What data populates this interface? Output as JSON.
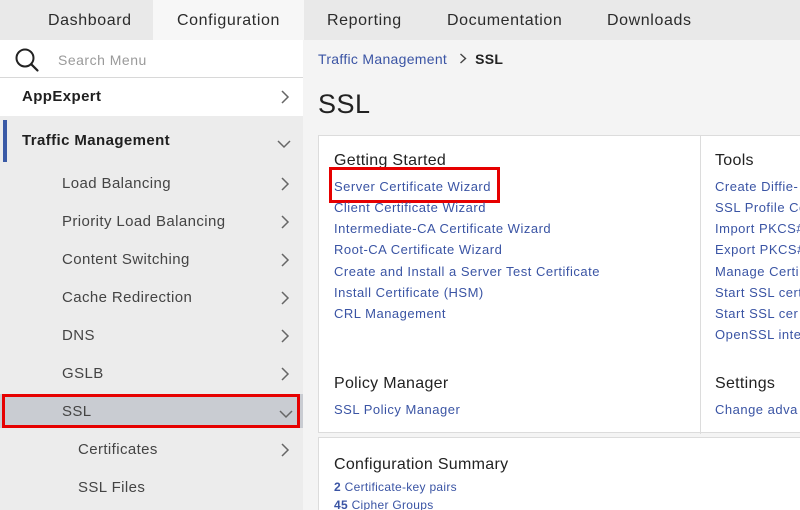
{
  "tabs": [
    {
      "label": "Dashboard"
    },
    {
      "label": "Configuration"
    },
    {
      "label": "Reporting"
    },
    {
      "label": "Documentation"
    },
    {
      "label": "Downloads"
    }
  ],
  "sidebar": {
    "search": {
      "placeholder": "Search Menu"
    },
    "items": [
      {
        "label": "AppExpert"
      },
      {
        "label": "Traffic Management"
      },
      {
        "label": "Load Balancing"
      },
      {
        "label": "Priority Load Balancing"
      },
      {
        "label": "Content Switching"
      },
      {
        "label": "Cache Redirection"
      },
      {
        "label": "DNS"
      },
      {
        "label": "GSLB"
      },
      {
        "label": "SSL"
      },
      {
        "label": "Certificates"
      },
      {
        "label": "SSL Files"
      }
    ]
  },
  "breadcrumb": {
    "parent": "Traffic Management",
    "current": "SSL"
  },
  "page_title": "SSL",
  "getting_started": {
    "title": "Getting Started",
    "links": [
      "Server Certificate Wizard",
      "Client Certificate Wizard",
      "Intermediate-CA Certificate Wizard",
      "Root-CA Certificate Wizard",
      "Create and Install a Server Test Certificate",
      "Install Certificate (HSM)",
      "CRL Management"
    ]
  },
  "tools": {
    "title": "Tools",
    "links": [
      "Create Diffie-",
      "SSL Profile Co",
      "Import PKCS#",
      "Export PKCS#",
      "Manage Certi",
      "Start SSL cert",
      "Start SSL cer",
      "OpenSSL inte"
    ]
  },
  "policy_manager": {
    "title": "Policy Manager",
    "link": "SSL Policy Manager"
  },
  "settings": {
    "title": "Settings",
    "link": "Change adva"
  },
  "config_summary": {
    "title": "Configuration Summary",
    "rows": [
      {
        "count": "2",
        "label": "Certificate-key pairs"
      },
      {
        "count": "45",
        "label": "Cipher Groups"
      }
    ]
  },
  "colors": {
    "link": "#3a54a4",
    "highlight": "#e60000",
    "active_bar": "#3a5aa6"
  }
}
